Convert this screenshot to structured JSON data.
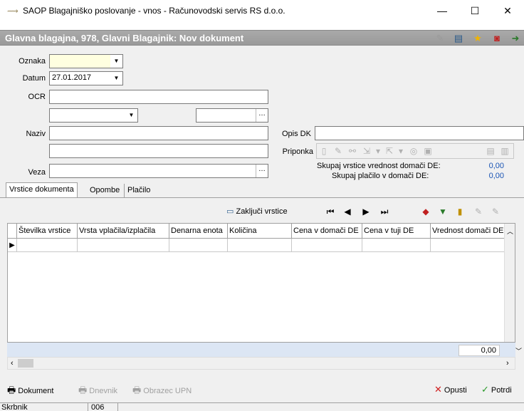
{
  "window": {
    "title": "SAOP Blagajniško poslovanje - vnos - Računovodski servis RS d.o.o.",
    "minimize": "—",
    "maximize": "☐",
    "close": "✕"
  },
  "header": {
    "title": "Glavna blagajna, 978, Glavni  Blagajnik: Nov dokument",
    "icons": [
      "edit-icon",
      "table-icon",
      "star-icon",
      "pdf-icon",
      "exit-icon"
    ]
  },
  "form": {
    "oznaka_label": "Oznaka",
    "oznaka_value": "",
    "datum_label": "Datum",
    "datum_value": "27.01.2017",
    "ocr_label": "OCR",
    "ocr_value": "",
    "naziv_label": "Naziv",
    "veza_label": "Veza",
    "opis_dk_label": "Opis DK",
    "priponka_label": "Priponka",
    "sum_vrstice_label": "Skupaj vrstice vrednost domači DE:",
    "sum_vrstice_value": "0,00",
    "sum_placilo_label": "Skupaj plačilo v domači DE:",
    "sum_placilo_value": "0,00"
  },
  "tabs": {
    "vrstice": "Vrstice dokumenta",
    "opombe": "Opombe",
    "placilo": "Plačilo"
  },
  "grid_toolbar": {
    "zakljuci": "Zaključi vrstice"
  },
  "grid": {
    "columns": [
      "Številka vrstice",
      "Vrsta vplačila/izplačila",
      "Denarna enota",
      "Količina",
      "Cena v domači DE",
      "Cena v tuji DE",
      "Vrednost domači DE"
    ],
    "total": "0,00"
  },
  "bottom": {
    "dokument": "Dokument",
    "dnevnik": "Dnevnik",
    "obrazec_upn": "Obrazec UPN",
    "opusti": "Opusti",
    "potrdi": "Potrdi"
  },
  "status": {
    "user": "Skrbnik",
    "code": "006"
  },
  "colors": {
    "header_bg": "#a0a0a0",
    "sum_value": "#1a54b4",
    "oznaka_bg": "#ffffe0"
  }
}
